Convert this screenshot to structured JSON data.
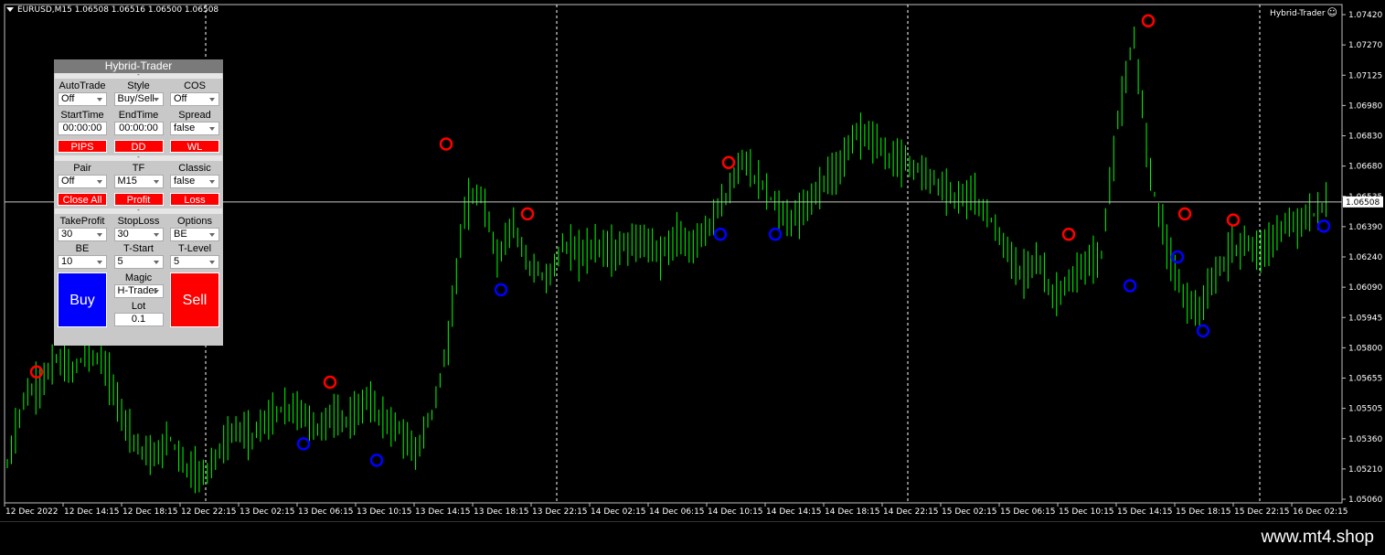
{
  "chart": {
    "symbol_label": "EURUSD,M15  1.06508 1.06516 1.06500 1.06508",
    "ea_label": "Hybrid-Trader",
    "price_ticks": [
      "1.07420",
      "1.07270",
      "1.07125",
      "1.06980",
      "1.06830",
      "1.06680",
      "1.06535",
      "1.06390",
      "1.06240",
      "1.06090",
      "1.05945",
      "1.05800",
      "1.05655",
      "1.05505",
      "1.05360",
      "1.05210",
      "1.05060"
    ],
    "current_price": "1.06508",
    "time_ticks": [
      "12 Dec 2022",
      "12 Dec 14:15",
      "12 Dec 18:15",
      "12 Dec 22:15",
      "13 Dec 02:15",
      "13 Dec 06:15",
      "13 Dec 10:15",
      "13 Dec 14:15",
      "13 Dec 18:15",
      "13 Dec 22:15",
      "14 Dec 02:15",
      "14 Dec 06:15",
      "14 Dec 10:15",
      "14 Dec 14:15",
      "14 Dec 18:15",
      "14 Dec 22:15",
      "15 Dec 02:15",
      "15 Dec 06:15",
      "15 Dec 10:15",
      "15 Dec 14:15",
      "15 Dec 18:15",
      "15 Dec 22:15",
      "16 Dec 02:15"
    ],
    "colors": {
      "background": "#000000",
      "candles": "#00ff00",
      "grid": "#ffffff",
      "sell_signal": "#ff0000",
      "buy_signal": "#0000ff"
    }
  },
  "chart_data": {
    "type": "line",
    "title": "",
    "xlabel": "",
    "ylabel": "",
    "ylim": [
      1.05,
      1.0752
    ],
    "series": [
      {
        "values": [
          1.0522,
          1.0555,
          1.0562,
          1.0574,
          1.0569,
          1.0578,
          1.057,
          1.0548,
          1.0532,
          1.0526,
          1.0536,
          1.0521,
          1.0518,
          1.053,
          1.054,
          1.0537,
          1.0545,
          1.055,
          1.0548,
          1.054,
          1.0547,
          1.0544,
          1.0555,
          1.0545,
          1.054,
          1.0528,
          1.0548,
          1.0582,
          1.0648,
          1.0654,
          1.0624,
          1.064,
          1.062,
          1.0612,
          1.063,
          1.0625,
          1.063,
          1.0626,
          1.063,
          1.0632,
          1.0625,
          1.0633,
          1.063,
          1.064,
          1.0652,
          1.0673,
          1.066,
          1.065,
          1.064,
          1.065,
          1.066,
          1.0668,
          1.0686,
          1.0682,
          1.0672,
          1.067,
          1.0666,
          1.066,
          1.0652,
          1.0655,
          1.0645,
          1.063,
          1.0615,
          1.0624,
          1.0605,
          1.061,
          1.062,
          1.0625,
          1.069,
          1.073,
          1.0664,
          1.063,
          1.0605,
          1.0597,
          1.0615,
          1.0628,
          1.063,
          1.0627,
          1.0638,
          1.064,
          1.0645,
          1.0652
        ]
      }
    ],
    "sell_signals": [
      1.0568,
      1.0563,
      1.0679,
      1.0645,
      1.067,
      1.0635,
      1.0739,
      1.0645,
      1.0642
    ],
    "buy_signals": [
      1.0533,
      1.0525,
      1.0608,
      1.0635,
      1.0635,
      1.061,
      1.0624,
      1.0588,
      1.0639
    ]
  },
  "panel": {
    "title": "Hybrid-Trader",
    "sep_glyph": "-",
    "section1": {
      "row1": [
        {
          "label": "AutoTrade",
          "value": "Off"
        },
        {
          "label": "Style",
          "value": "Buy/Sell"
        },
        {
          "label": "COS",
          "value": "Off"
        }
      ],
      "row2": [
        {
          "label": "StartTime",
          "value": "00:00:00"
        },
        {
          "label": "EndTime",
          "value": "00:00:00"
        },
        {
          "label": "Spread",
          "value": "false"
        }
      ],
      "buttons": [
        "PIPS",
        "DD",
        "WL"
      ]
    },
    "section2": {
      "row1": [
        {
          "label": "Pair",
          "value": "Off"
        },
        {
          "label": "TF",
          "value": "M15"
        },
        {
          "label": "Classic",
          "value": "false"
        }
      ],
      "buttons": [
        "Close All",
        "Profit",
        "Loss"
      ]
    },
    "section3": {
      "row1": [
        {
          "label": "TakeProfit",
          "value": "30"
        },
        {
          "label": "StopLoss",
          "value": "30"
        },
        {
          "label": "Options",
          "value": "BE"
        }
      ],
      "row2": [
        {
          "label": "BE",
          "value": "10"
        },
        {
          "label": "T-Start",
          "value": "5"
        },
        {
          "label": "T-Level",
          "value": "5"
        }
      ],
      "buy_label": "Buy",
      "sell_label": "Sell",
      "magic_label": "Magic",
      "magic_value": "H-Trader",
      "lot_label": "Lot",
      "lot_value": "0.1"
    }
  },
  "footer": {
    "text": "www.mt4.shop"
  }
}
